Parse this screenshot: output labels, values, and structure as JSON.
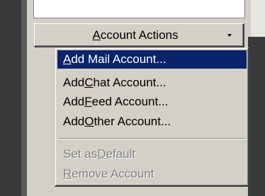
{
  "account_actions_button": {
    "label_pre": "",
    "label_acc": "A",
    "label_post": "ccount Actions"
  },
  "menu": {
    "items": [
      {
        "pre": "",
        "acc": "A",
        "post": "dd Mail Account...",
        "state": "selected"
      },
      {
        "pre": "Add ",
        "acc": "C",
        "post": "hat Account...",
        "state": "normal"
      },
      {
        "pre": "Add ",
        "acc": "F",
        "post": "eed Account...",
        "state": "normal"
      },
      {
        "pre": "Add ",
        "acc": "O",
        "post": "ther Account...",
        "state": "normal"
      },
      {
        "pre": "Set as ",
        "acc": "D",
        "post": "efault",
        "state": "disabled"
      },
      {
        "pre": "",
        "acc": "R",
        "post": "emove Account",
        "state": "disabled"
      }
    ]
  },
  "colors": {
    "face": "#d4d0c8",
    "highlight": "#0a246a",
    "disabled_text": "#808080",
    "dark_background": "#3a3a3a"
  }
}
